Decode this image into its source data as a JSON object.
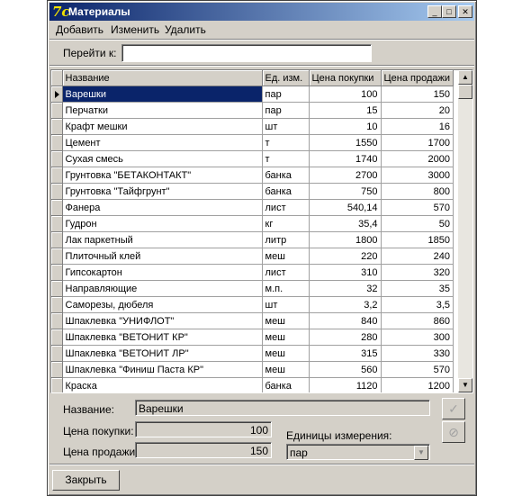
{
  "window": {
    "title": "Материалы",
    "icon_glyph": "7c"
  },
  "menu": {
    "items": [
      "Добавить",
      "Изменить",
      "Удалить"
    ]
  },
  "goto": {
    "label": "Перейти к:",
    "value": ""
  },
  "grid": {
    "columns": [
      "Название",
      "Ед. изм.",
      "Цена покупки",
      "Цена продажи"
    ],
    "selected_index": 0,
    "rows": [
      [
        "Варешки",
        "пар",
        "100",
        "150"
      ],
      [
        "Перчатки",
        "пар",
        "15",
        "20"
      ],
      [
        "Крафт мешки",
        "шт",
        "10",
        "16"
      ],
      [
        "Цемент",
        "т",
        "1550",
        "1700"
      ],
      [
        "Сухая смесь",
        "т",
        "1740",
        "2000"
      ],
      [
        "Грунтовка \"БЕТАКОНТАКТ\"",
        "банка",
        "2700",
        "3000"
      ],
      [
        "Грунтовка \"Тайфгрунт\"",
        "банка",
        "750",
        "800"
      ],
      [
        "Фанера",
        "лист",
        "540,14",
        "570"
      ],
      [
        "Гудрон",
        "кг",
        "35,4",
        "50"
      ],
      [
        "Лак паркетный",
        "литр",
        "1800",
        "1850"
      ],
      [
        "Плиточный клей",
        "меш",
        "220",
        "240"
      ],
      [
        "Гипсокартон",
        "лист",
        "310",
        "320"
      ],
      [
        "Направляющие",
        "м.п.",
        "32",
        "35"
      ],
      [
        "Саморезы, дюбеля",
        "шт",
        "3,2",
        "3,5"
      ],
      [
        "Шпаклевка \"УНИФЛОТ\"",
        "меш",
        "840",
        "860"
      ],
      [
        "Шпаклевка \"ВЕТОНИТ КР\"",
        "меш",
        "280",
        "300"
      ],
      [
        "Шпаклевка \"ВЕТОНИТ ЛР\"",
        "меш",
        "315",
        "330"
      ],
      [
        "Шпаклевка \"Финиш Паста КР\"",
        "меш",
        "560",
        "570"
      ],
      [
        "Краска",
        "банка",
        "1120",
        "1200"
      ]
    ]
  },
  "detail": {
    "name_label": "Название:",
    "name_value": "Варешки",
    "buy_label": "Цена покупки:",
    "buy_value": "100",
    "sell_label": "Цена продажи:",
    "sell_value": "150",
    "unit_label": "Единицы измерения:",
    "unit_value": "пар"
  },
  "buttons": {
    "close_label": "Закрыть"
  },
  "colors": {
    "titlebar_start": "#0a246a",
    "titlebar_end": "#a6caf0",
    "selection": "#0a246a",
    "face": "#d4d0c8"
  }
}
